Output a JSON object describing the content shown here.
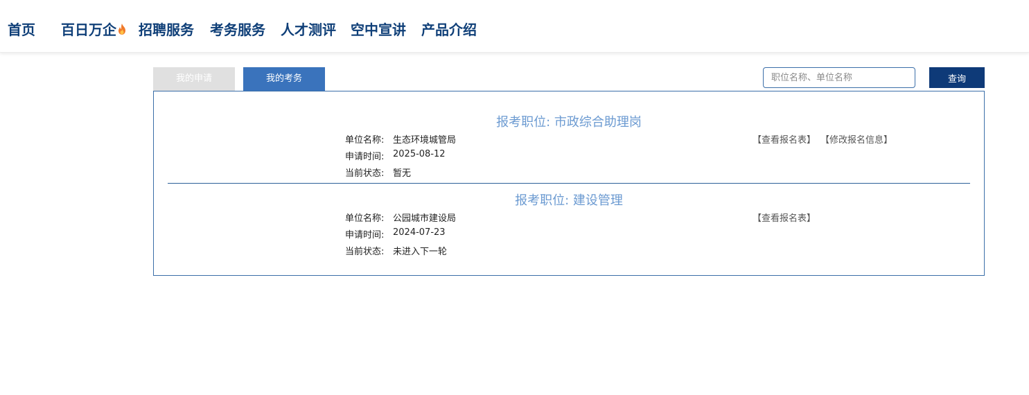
{
  "nav": {
    "items": [
      {
        "label": "首页"
      },
      {
        "label": "百日万企"
      },
      {
        "label": "招聘服务"
      },
      {
        "label": "考务服务"
      },
      {
        "label": "人才测评"
      },
      {
        "label": "空中宣讲"
      },
      {
        "label": "产品介绍"
      }
    ],
    "hot_icon": "fire-icon"
  },
  "tabs": [
    {
      "label": "我的申请",
      "active": false
    },
    {
      "label": "我的考务",
      "active": true
    }
  ],
  "search": {
    "placeholder": "职位名称、单位名称",
    "button_label": "查询"
  },
  "labels": {
    "unit": "单位名称:",
    "apply_time": "申请时间:",
    "status": "当前状态:"
  },
  "records": [
    {
      "title": "报考职位: 市政综合助理岗",
      "unit": "生态环境城管局",
      "apply_time": "2025-08-12",
      "status": "暂无",
      "actions": [
        "【查看报名表】",
        "【修改报名信息】"
      ]
    },
    {
      "title": "报考职位: 建设管理",
      "unit": "公园城市建设局",
      "apply_time": "2024-07-23",
      "status": "未进入下一轮",
      "actions": [
        "【查看报名表】"
      ]
    }
  ],
  "colors": {
    "nav_text": "#0f3f78",
    "tab_active": "#3a73bc",
    "tab_inactive": "#e0e0e0",
    "search_button": "#0e3a78",
    "record_title": "#6b9ad1",
    "panel_border": "#3a6ea8"
  }
}
